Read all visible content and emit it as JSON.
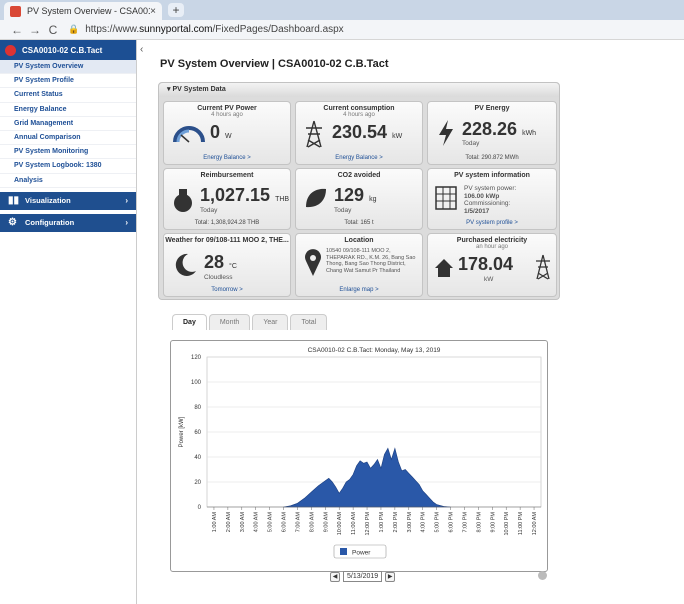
{
  "browser": {
    "tab_title": "PV System Overview - CSA0010-",
    "tab_close": "×",
    "new_tab": "+",
    "url_prefix": "https://www.",
    "url_domain": "sunnyportal.com",
    "url_path": "/FixedPages/Dashboard.aspx",
    "back": "←",
    "forward": "→",
    "reload": "C",
    "lock": "🔒"
  },
  "sidebar": {
    "system_name": "CSA0010-02 C.B.Tact",
    "collapse": "‹",
    "items": [
      {
        "label": "PV System Overview"
      },
      {
        "label": "PV System Profile"
      },
      {
        "label": "Current Status"
      },
      {
        "label": "Energy Balance"
      },
      {
        "label": "Grid Management"
      },
      {
        "label": "Annual Comparison"
      },
      {
        "label": "PV System Monitoring"
      },
      {
        "label": "PV System Logbook: 1380"
      },
      {
        "label": "Analysis"
      }
    ],
    "sections": [
      {
        "label": "Visualization",
        "chev": "›"
      },
      {
        "label": "Configuration",
        "chev": "›"
      }
    ]
  },
  "page_title": "PV System Overview | CSA0010-02 C.B.Tact",
  "panel_title": "PV System Data",
  "tiles": {
    "pv_power": {
      "title": "Current PV Power",
      "age": "4 hours ago",
      "value": "0",
      "unit": "W",
      "link": "Energy Balance >"
    },
    "consumption": {
      "title": "Current consumption",
      "age": "4 hours ago",
      "value": "230.54",
      "unit": "kW",
      "link": "Energy Balance >"
    },
    "energy": {
      "title": "PV Energy",
      "value": "228.26",
      "unit": "kWh",
      "sub": "Today",
      "foot": "Total: 290.872 MWh"
    },
    "reimburse": {
      "title": "Reimbursement",
      "value": "1,027.15",
      "unit": "THB",
      "sub": "Today",
      "foot": "Total: 1,308,924.28 THB"
    },
    "co2": {
      "title": "CO2 avoided",
      "value": "129",
      "unit": "kg",
      "sub": "Today",
      "foot": "Total: 165 t"
    },
    "info": {
      "title": "PV system information",
      "l1": "PV system power:",
      "l2": "106.00 kWp",
      "l3": "Commissioning:",
      "l4": "1/5/2017",
      "link": "PV system profile >"
    },
    "weather": {
      "title": "Weather for 09/108-111 MOO 2, THE...",
      "value": "28",
      "unit": "°C",
      "sub": "Cloudless",
      "link": "Tomorrow >"
    },
    "location": {
      "title": "Location",
      "addr": "10540 09/108-111 MOO 2, THEPARAK RD., K.M. 26, Bang Sao Thong, Bang Sao Thong District, Chang Wat Samut Pr Thailand",
      "link": "Enlarge map >"
    },
    "purchased": {
      "title": "Purchased electricity",
      "age": "an hour ago",
      "value": "178.04",
      "unit": "kW"
    }
  },
  "chart_tabs": [
    {
      "label": "Day"
    },
    {
      "label": "Month"
    },
    {
      "label": "Year"
    },
    {
      "label": "Total"
    }
  ],
  "date_nav": {
    "prev": "◀",
    "date": "5/13/2019",
    "next": "▶"
  },
  "chart_data": {
    "type": "area",
    "title": "CSA0010-02 C.B.Tact: Monday, May 13, 2019",
    "xlabel": "",
    "ylabel": "Power [kW]",
    "ylim": [
      0,
      120
    ],
    "yticks": [
      0,
      20,
      40,
      60,
      80,
      100,
      120
    ],
    "xticks": [
      "1:00 AM",
      "2:00 AM",
      "3:00 AM",
      "4:00 AM",
      "5:00 AM",
      "6:00 AM",
      "7:00 AM",
      "8:00 AM",
      "9:00 AM",
      "10:00 AM",
      "11:00 AM",
      "12:00 PM",
      "1:00 PM",
      "2:00 PM",
      "3:00 PM",
      "4:00 PM",
      "5:00 PM",
      "6:00 PM",
      "7:00 PM",
      "8:00 PM",
      "9:00 PM",
      "10:00 PM",
      "11:00 PM",
      "12:00 AM"
    ],
    "legend": "Power",
    "color": "#2a58a8",
    "series": [
      {
        "name": "Power",
        "x": [
          6,
          6.5,
          7,
          7.5,
          8,
          8.5,
          9,
          9.25,
          9.5,
          9.75,
          10,
          10.25,
          10.5,
          10.75,
          11,
          11.25,
          11.5,
          11.75,
          12,
          12.25,
          12.5,
          12.75,
          13,
          13.25,
          13.5,
          13.75,
          14,
          14.25,
          14.5,
          14.75,
          15,
          15.25,
          15.5,
          15.75,
          16,
          16.25,
          16.5,
          16.75,
          17,
          17.5,
          18
        ],
        "y": [
          0,
          1,
          3,
          7,
          12,
          17,
          21,
          23,
          20,
          16,
          11,
          15,
          20,
          22,
          26,
          33,
          37,
          35,
          36,
          31,
          34,
          38,
          31,
          42,
          47,
          38,
          47,
          36,
          29,
          30,
          27,
          24,
          21,
          18,
          13,
          10,
          7,
          4,
          2,
          0.5,
          0
        ]
      }
    ]
  }
}
